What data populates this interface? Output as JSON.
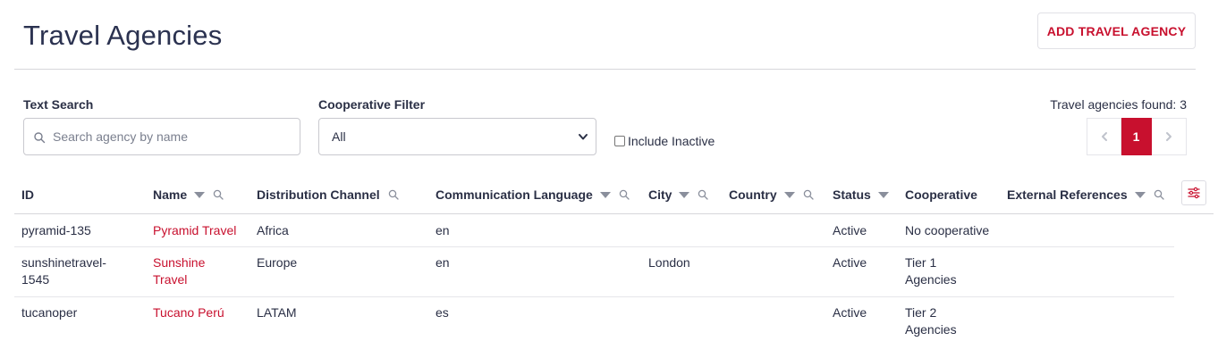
{
  "header": {
    "title": "Travel Agencies",
    "add_button_label": "ADD TRAVEL AGENCY"
  },
  "filters": {
    "text_search_label": "Text Search",
    "search_placeholder": "Search agency by name",
    "search_value": "",
    "cooperative_label": "Cooperative Filter",
    "cooperative_selected": "All",
    "include_inactive_label": "Include Inactive",
    "include_inactive_checked": false
  },
  "results": {
    "found_text": "Travel agencies found: 3",
    "pagination": {
      "current_page": "1",
      "prev_icon": "chevron-left-icon",
      "next_icon": "chevron-right-icon"
    }
  },
  "table": {
    "columns": [
      {
        "label": "ID",
        "sortable": false,
        "searchable": false
      },
      {
        "label": "Name",
        "sortable": true,
        "searchable": true
      },
      {
        "label": "Distribution Channel",
        "sortable": true,
        "searchable": true
      },
      {
        "label": "Communication Language",
        "sortable": true,
        "searchable": true
      },
      {
        "label": "City",
        "sortable": true,
        "searchable": true
      },
      {
        "label": "Country",
        "sortable": true,
        "searchable": true
      },
      {
        "label": "Status",
        "sortable": true,
        "searchable": false
      },
      {
        "label": "Cooperative",
        "sortable": false,
        "searchable": false
      },
      {
        "label": "External References",
        "sortable": true,
        "searchable": true
      }
    ],
    "rows": [
      {
        "id": "pyramid-135",
        "name": "Pyramid Travel",
        "channel": "Africa",
        "language": "en",
        "city": "",
        "country": "",
        "status": "Active",
        "cooperative": "No cooperative",
        "external": ""
      },
      {
        "id_line1": "sunshinetravel-",
        "id_line2": "1545",
        "name_line1": "Sunshine",
        "name_line2": "Travel",
        "channel": "Europe",
        "language": "en",
        "city": "London",
        "country": "",
        "status": "Active",
        "coop_line1": "Tier 1",
        "coop_line2": "Agencies",
        "external": ""
      },
      {
        "id": "tucanoper",
        "name": "Tucano Perú",
        "channel": "LATAM",
        "language": "es",
        "city": "",
        "country": "",
        "status": "Active",
        "coop_line1": "Tier 2",
        "coop_line2": "Agencies",
        "external": ""
      }
    ]
  },
  "colors": {
    "accent": "#c8102e",
    "text": "#2a2f45",
    "divider": "#d6d6db"
  }
}
